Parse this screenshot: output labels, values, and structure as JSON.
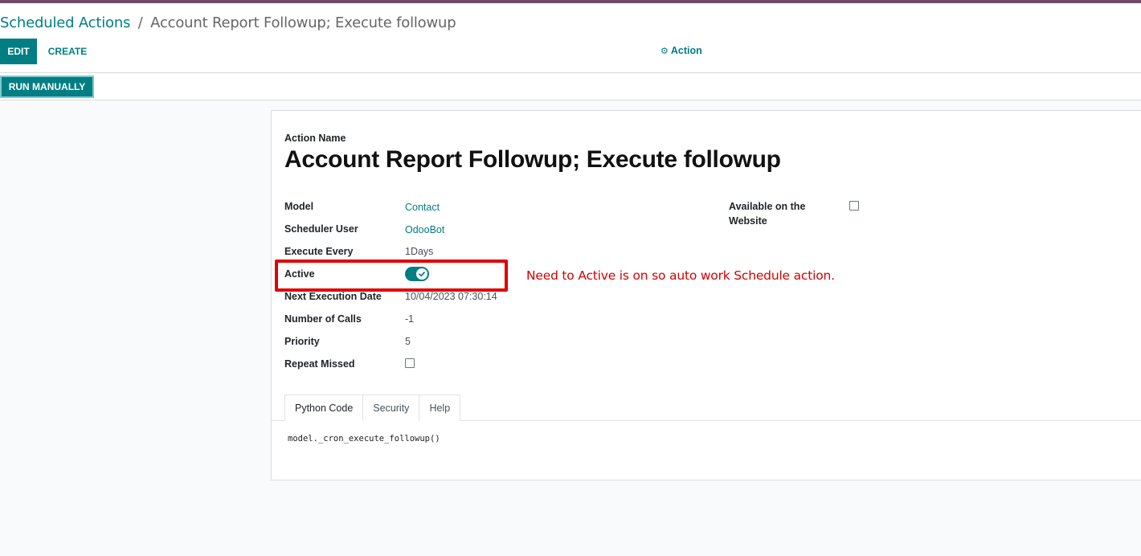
{
  "breadcrumb": {
    "parent": "Scheduled Actions",
    "separator": "/",
    "current": "Account Report Followup; Execute followup"
  },
  "toolbar": {
    "edit_label": "EDIT",
    "create_label": "CREATE",
    "action_label": "Action"
  },
  "statusbar": {
    "run_label": "RUN MANUALLY"
  },
  "form": {
    "action_name_label": "Action Name",
    "title": "Account Report Followup; Execute followup",
    "fields": {
      "model": {
        "label": "Model",
        "value": "Contact"
      },
      "scheduler_user": {
        "label": "Scheduler User",
        "value": "OdooBot"
      },
      "execute_every": {
        "label": "Execute Every",
        "value": "1Days"
      },
      "active": {
        "label": "Active",
        "value": true
      },
      "next_execution": {
        "label": "Next Execution Date",
        "value": "10/04/2023 07:30:14"
      },
      "number_of_calls": {
        "label": "Number of Calls",
        "value": "-1"
      },
      "priority": {
        "label": "Priority",
        "value": "5"
      },
      "repeat_missed": {
        "label": "Repeat Missed",
        "value": false
      },
      "available_website": {
        "label_line1": "Available on the",
        "label_line2": "Website",
        "value": false
      }
    },
    "tabs": [
      {
        "label": "Python Code",
        "active": true
      },
      {
        "label": "Security",
        "active": false
      },
      {
        "label": "Help",
        "active": false
      }
    ],
    "code": "model._cron_execute_followup()"
  },
  "annotation": {
    "text": "Need to Active is on so auto work Schedule action.",
    "color": "#e00000"
  },
  "colors": {
    "brand_top": "#714B67",
    "primary": "#017e84"
  },
  "icons": {
    "action": "gear-icon",
    "toggle": "check-icon"
  }
}
